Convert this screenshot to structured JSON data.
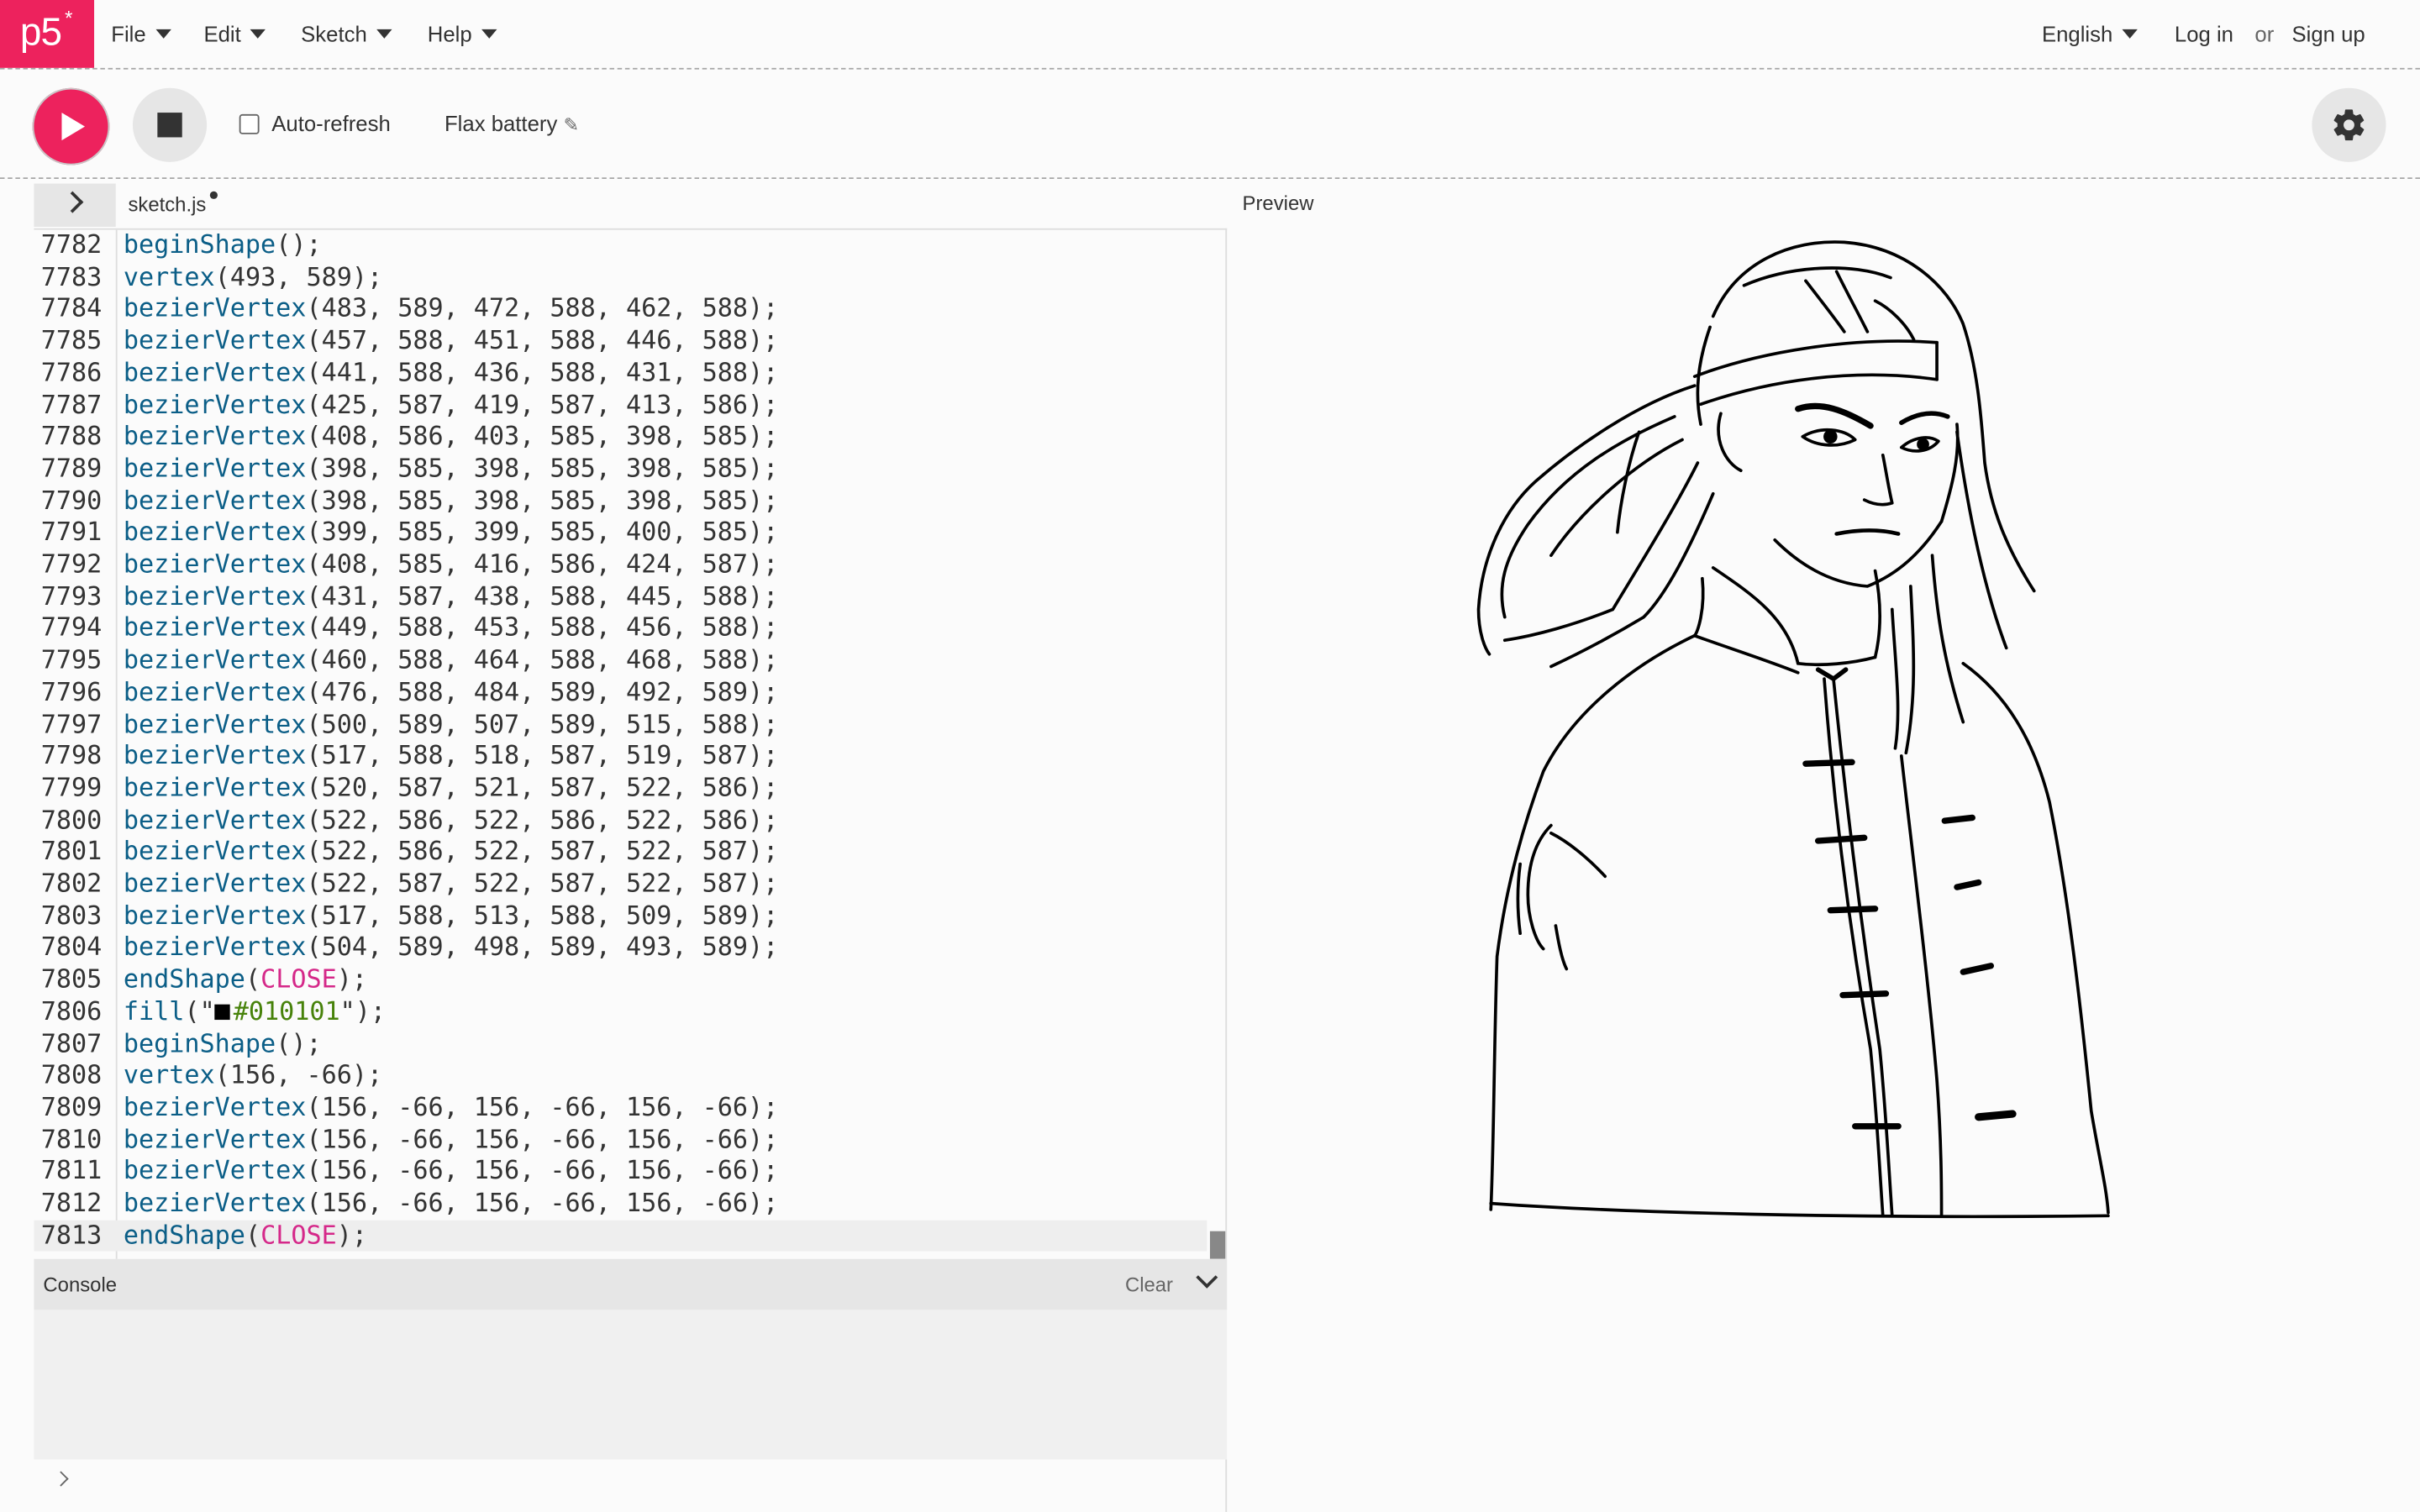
{
  "nav": {
    "logo": "p5",
    "logo_star": "*",
    "menus": [
      "File",
      "Edit",
      "Sketch",
      "Help"
    ],
    "language": "English",
    "login": "Log in",
    "or": "or",
    "signup": "Sign up"
  },
  "toolbar": {
    "auto_refresh_label": "Auto-refresh",
    "auto_refresh_checked": false,
    "sketch_name": "Flax battery"
  },
  "editor": {
    "file_name": "sketch.js",
    "unsaved": true,
    "active_line": 7813,
    "lines": [
      {
        "n": "7782",
        "fn": "beginShape",
        "args": "();"
      },
      {
        "n": "7783",
        "fn": "vertex",
        "args": "(493, 589);"
      },
      {
        "n": "7784",
        "fn": "bezierVertex",
        "args": "(483, 589, 472, 588, 462, 588);"
      },
      {
        "n": "7785",
        "fn": "bezierVertex",
        "args": "(457, 588, 451, 588, 446, 588);"
      },
      {
        "n": "7786",
        "fn": "bezierVertex",
        "args": "(441, 588, 436, 588, 431, 588);"
      },
      {
        "n": "7787",
        "fn": "bezierVertex",
        "args": "(425, 587, 419, 587, 413, 586);"
      },
      {
        "n": "7788",
        "fn": "bezierVertex",
        "args": "(408, 586, 403, 585, 398, 585);"
      },
      {
        "n": "7789",
        "fn": "bezierVertex",
        "args": "(398, 585, 398, 585, 398, 585);"
      },
      {
        "n": "7790",
        "fn": "bezierVertex",
        "args": "(398, 585, 398, 585, 398, 585);"
      },
      {
        "n": "7791",
        "fn": "bezierVertex",
        "args": "(399, 585, 399, 585, 400, 585);"
      },
      {
        "n": "7792",
        "fn": "bezierVertex",
        "args": "(408, 585, 416, 586, 424, 587);"
      },
      {
        "n": "7793",
        "fn": "bezierVertex",
        "args": "(431, 587, 438, 588, 445, 588);"
      },
      {
        "n": "7794",
        "fn": "bezierVertex",
        "args": "(449, 588, 453, 588, 456, 588);"
      },
      {
        "n": "7795",
        "fn": "bezierVertex",
        "args": "(460, 588, 464, 588, 468, 588);"
      },
      {
        "n": "7796",
        "fn": "bezierVertex",
        "args": "(476, 588, 484, 589, 492, 589);"
      },
      {
        "n": "7797",
        "fn": "bezierVertex",
        "args": "(500, 589, 507, 589, 515, 588);"
      },
      {
        "n": "7798",
        "fn": "bezierVertex",
        "args": "(517, 588, 518, 587, 519, 587);"
      },
      {
        "n": "7799",
        "fn": "bezierVertex",
        "args": "(520, 587, 521, 587, 522, 586);"
      },
      {
        "n": "7800",
        "fn": "bezierVertex",
        "args": "(522, 586, 522, 586, 522, 586);"
      },
      {
        "n": "7801",
        "fn": "bezierVertex",
        "args": "(522, 586, 522, 587, 522, 587);"
      },
      {
        "n": "7802",
        "fn": "bezierVertex",
        "args": "(522, 587, 522, 587, 522, 587);"
      },
      {
        "n": "7803",
        "fn": "bezierVertex",
        "args": "(517, 588, 513, 588, 509, 589);"
      },
      {
        "n": "7804",
        "fn": "bezierVertex",
        "args": "(504, 589, 498, 589, 493, 589);"
      },
      {
        "n": "7805",
        "fn": "endShape",
        "open": "(",
        "const": "CLOSE",
        "close": ");"
      },
      {
        "n": "7806",
        "fn": "fill",
        "open": "(\"",
        "swatch": "#010101",
        "str": "#010101",
        "close": "\");"
      },
      {
        "n": "7807",
        "fn": "beginShape",
        "args": "();"
      },
      {
        "n": "7808",
        "fn": "vertex",
        "args": "(156, -66);"
      },
      {
        "n": "7809",
        "fn": "bezierVertex",
        "args": "(156, -66, 156, -66, 156, -66);"
      },
      {
        "n": "7810",
        "fn": "bezierVertex",
        "args": "(156, -66, 156, -66, 156, -66);"
      },
      {
        "n": "7811",
        "fn": "bezierVertex",
        "args": "(156, -66, 156, -66, 156, -66);"
      },
      {
        "n": "7812",
        "fn": "bezierVertex",
        "args": "(156, -66, 156, -66, 156, -66);"
      },
      {
        "n": "7813",
        "fn": "endShape",
        "open": "(",
        "const": "CLOSE",
        "close": ");"
      }
    ]
  },
  "console": {
    "title": "Console",
    "clear_label": "Clear"
  },
  "preview": {
    "label": "Preview"
  },
  "colors": {
    "brand": "#ed225d",
    "code_function": "#0b5e87",
    "code_constant": "#d52889",
    "code_string": "#47820a"
  }
}
